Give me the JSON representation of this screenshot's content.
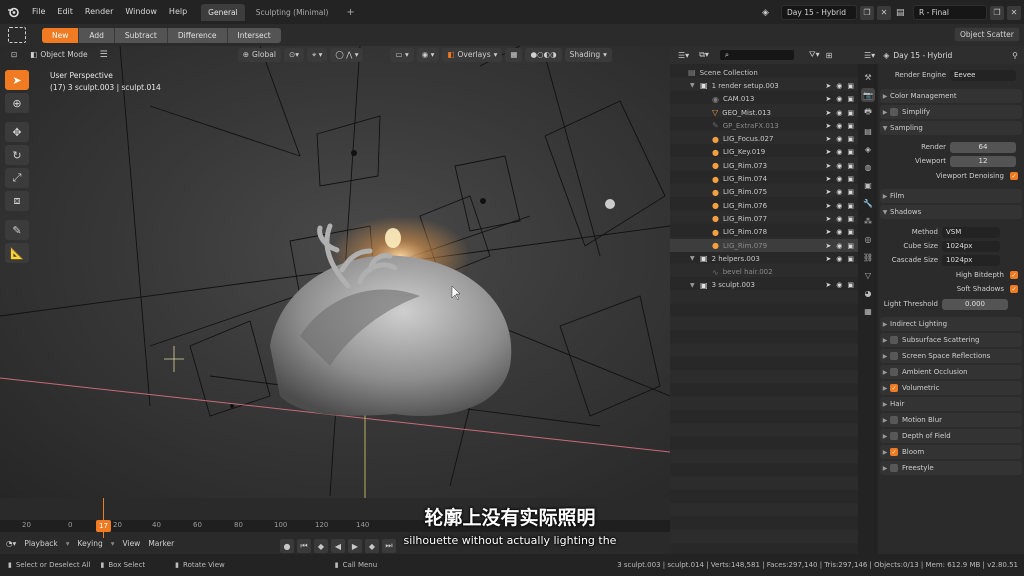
{
  "topbar": {
    "menus": [
      "File",
      "Edit",
      "Render",
      "Window",
      "Help"
    ],
    "workspace_tabs": [
      {
        "label": "General",
        "active": true
      },
      {
        "label": "Sculpting (Minimal)",
        "active": false
      }
    ],
    "add_tab": "+",
    "scene_name": "Day 15 - Hybrid",
    "view_layer": "R - Final",
    "object_scatter": "Object Scatter"
  },
  "bool_bar": {
    "buttons": [
      "New",
      "Add",
      "Subtract",
      "Difference",
      "Intersect"
    ]
  },
  "viewport": {
    "mode": "Object Mode",
    "orientation": "Global",
    "overlays": "Overlays",
    "shading": "Shading",
    "perspective_label": "User Perspective",
    "object_label": "(17) 3 sculpt.003 | sculpt.014"
  },
  "timeline": {
    "frame_ticks": [
      "20",
      "0",
      "17",
      "20",
      "40",
      "60",
      "80",
      "100",
      "120",
      "140"
    ],
    "current_frame": "17",
    "menus": [
      "Playback",
      "Keying",
      "View",
      "Marker"
    ]
  },
  "subtitle": {
    "zh": "轮廓上没有实际照明",
    "en": "silhouette without actually lighting the"
  },
  "outliner": {
    "title": "Scene Collection",
    "rows": [
      {
        "label": "Scene Collection",
        "depth": 0,
        "kind": "scene"
      },
      {
        "label": "1 render setup.003",
        "depth": 1,
        "kind": "collection"
      },
      {
        "label": "CAM.013",
        "depth": 2,
        "kind": "camera"
      },
      {
        "label": "GEO_Mist.013",
        "depth": 2,
        "kind": "mesh"
      },
      {
        "label": "GP_ExtraFX.013",
        "depth": 2,
        "kind": "gpencil"
      },
      {
        "label": "LIG_Focus.027",
        "depth": 2,
        "kind": "light"
      },
      {
        "label": "LIG_Key.019",
        "depth": 2,
        "kind": "light"
      },
      {
        "label": "LIG_Rim.073",
        "depth": 2,
        "kind": "light"
      },
      {
        "label": "LIG_Rim.074",
        "depth": 2,
        "kind": "light"
      },
      {
        "label": "LIG_Rim.075",
        "depth": 2,
        "kind": "light"
      },
      {
        "label": "LIG_Rim.076",
        "depth": 2,
        "kind": "light"
      },
      {
        "label": "LIG_Rim.077",
        "depth": 2,
        "kind": "light"
      },
      {
        "label": "LIG_Rim.078",
        "depth": 2,
        "kind": "light"
      },
      {
        "label": "LIG_Rim.079",
        "depth": 2,
        "kind": "light",
        "selected": true
      },
      {
        "label": "2 helpers.003",
        "depth": 1,
        "kind": "collection"
      },
      {
        "label": "bevel hair.002",
        "depth": 2,
        "kind": "curve"
      },
      {
        "label": "3 sculpt.003",
        "depth": 1,
        "kind": "collection"
      }
    ]
  },
  "properties": {
    "header": "Day 15 - Hybrid",
    "render_engine_label": "Render Engine",
    "render_engine": "Eevee",
    "sections_top": [
      "Color Management",
      "Simplify",
      "Sampling"
    ],
    "sampling": {
      "render_label": "Render",
      "render": "64",
      "viewport_label": "Viewport",
      "viewport": "12",
      "denoise_label": "Viewport Denoising"
    },
    "film": "Film",
    "shadows": {
      "title": "Shadows",
      "method_label": "Method",
      "method": "VSM",
      "cube_label": "Cube Size",
      "cube": "1024px",
      "cascade_label": "Cascade Size",
      "cascade": "1024px",
      "high_bitdepth": "High Bitdepth",
      "soft_shadows": "Soft Shadows",
      "light_threshold_label": "Light Threshold",
      "light_threshold": "0.000"
    },
    "sections_bottom": [
      {
        "label": "Indirect Lighting",
        "check": null
      },
      {
        "label": "Subsurface Scattering",
        "check": false
      },
      {
        "label": "Screen Space Reflections",
        "check": false
      },
      {
        "label": "Ambient Occlusion",
        "check": false
      },
      {
        "label": "Volumetric",
        "check": true
      },
      {
        "label": "Hair",
        "check": null
      },
      {
        "label": "Motion Blur",
        "check": false
      },
      {
        "label": "Depth of Field",
        "check": false
      },
      {
        "label": "Bloom",
        "check": true
      },
      {
        "label": "Freestyle",
        "check": false
      }
    ]
  },
  "status": {
    "left_hint_1": "Select or Deselect All",
    "left_hint_2": "Box Select",
    "left_hint_3": "Rotate View",
    "left_hint_4": "Call Menu",
    "stats": "3 sculpt.003 | sculpt.014 | Verts:148,581 | Faces:297,140 | Tris:297,146 | Objects:0/13 | Mem: 612.9 MB | v2.80.51"
  },
  "colors": {
    "accent": "#f07b22",
    "viewport_bg": "#383838",
    "panel": "#2b2b2b"
  }
}
